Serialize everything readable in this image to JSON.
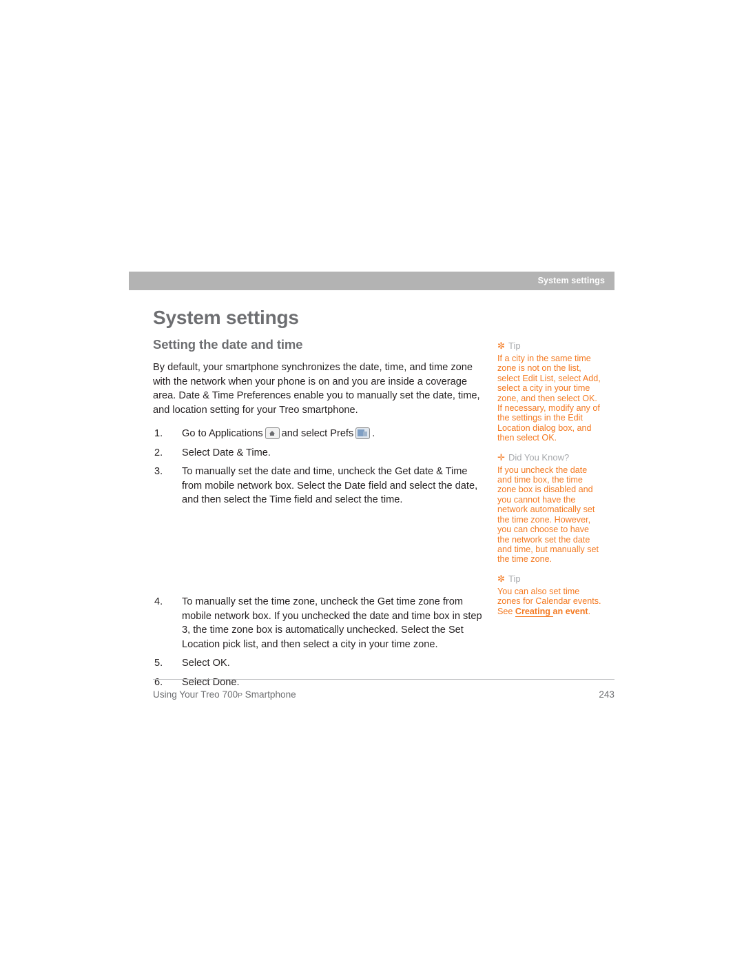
{
  "header": {
    "running_head": "System settings"
  },
  "main": {
    "title": "System settings",
    "subtitle": "Setting the date and time",
    "intro": "By default, your smartphone synchronizes the date, time, and time zone with the network when your phone is on and you are inside a coverage area. Date & Time Preferences enable you to manually set the date, time, and location setting for your Treo smartphone.",
    "steps_part1": [
      {
        "num": "1.",
        "text_before": "Go to Applications",
        "icon1": "home-icon",
        "text_middle": "and select Prefs",
        "icon2": "prefs-icon",
        "text_after": "."
      },
      {
        "num": "2.",
        "text": "Select Date & Time."
      },
      {
        "num": "3.",
        "text": "To manually set the date and time, uncheck the Get date & Time from mobile network box. Select the Date field and select the date, and then select the Time field and select the time."
      }
    ],
    "steps_part2": [
      {
        "num": "4.",
        "text": "To manually set the time zone, uncheck the Get time zone from mobile network box. If you unchecked the date and time box in step 3, the time zone box is automatically unchecked. Select the Set Location pick list, and then select a city in your time zone."
      },
      {
        "num": "5.",
        "text": "Select OK."
      },
      {
        "num": "6.",
        "text": "Select Done."
      }
    ]
  },
  "sidebar": [
    {
      "glyph": "✼",
      "label": "Tip",
      "body": "If a city in the same time zone is not on the list, select Edit List, select Add, select a city in your time zone, and then select OK. If necessary, modify any of the settings in the Edit Location dialog box, and then select OK."
    },
    {
      "glyph": "✛",
      "label": "Did You Know?",
      "body": "If you uncheck the date and time box, the time zone box is disabled and you cannot have the network automatically set the time zone. However, you can choose to have the network set the date and time, but manually set the time zone."
    },
    {
      "glyph": "✼",
      "label": "Tip",
      "body_before": "You can also set time zones for Calendar events. See ",
      "link": "Creating ",
      "link2": "an event",
      "body_after": "."
    }
  ],
  "footer": {
    "text_before": "Using Your Treo 700",
    "sub": "P",
    "text_after": " Smartphone",
    "page_number": "243"
  }
}
